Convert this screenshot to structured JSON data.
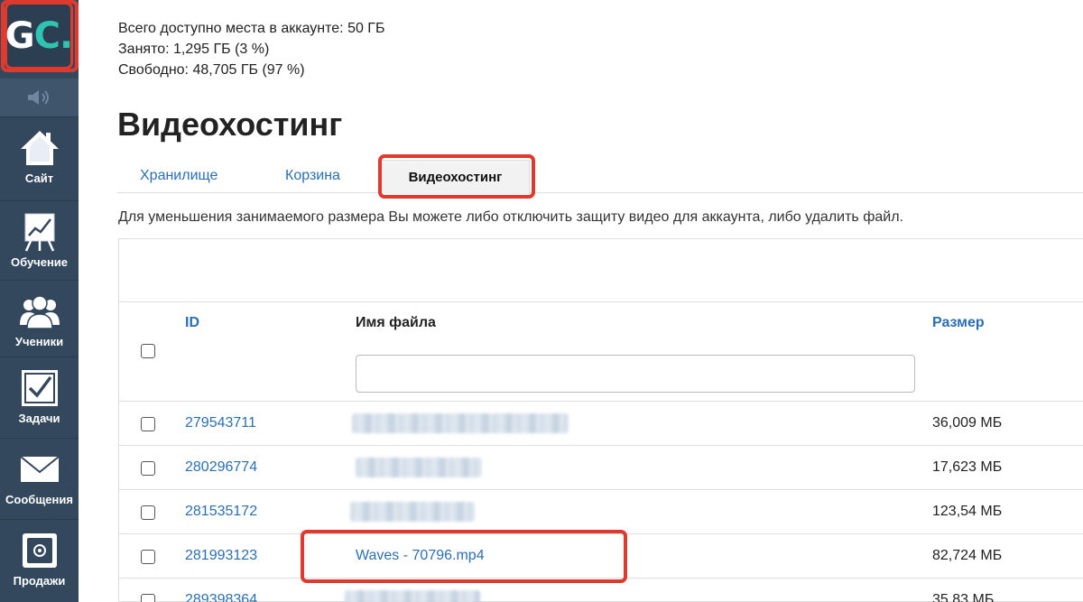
{
  "sidebar": {
    "logo": {
      "letter1": "G",
      "letter2": "C",
      "dot": "."
    },
    "speaker_icon": "speaker-icon",
    "items": [
      {
        "label": "Сайт",
        "icon": "house-icon"
      },
      {
        "label": "Обучение",
        "icon": "chart-board-icon"
      },
      {
        "label": "Ученики",
        "icon": "users-icon"
      },
      {
        "label": "Задачи",
        "icon": "checkbox-icon"
      },
      {
        "label": "Сообщения",
        "icon": "envelope-icon"
      },
      {
        "label": "Продажи",
        "icon": "safe-icon"
      }
    ]
  },
  "storage": {
    "total": "Всего доступно места в аккаунте: 50 ГБ",
    "used": "Занято: 1,295 ГБ (3 %)",
    "free": "Свободно: 48,705 ГБ (97 %)"
  },
  "page_title": "Видеохостинг",
  "tabs": [
    {
      "label": "Хранилище"
    },
    {
      "label": "Корзина"
    },
    {
      "label": "Видеохостинг",
      "active": true
    }
  ],
  "info_text": "Для уменьшения занимаемого размера Вы можете либо отключить защиту видео для аккаунта, либо удалить файл.",
  "table": {
    "columns": {
      "id": "ID",
      "filename": "Имя файла",
      "size": "Размер"
    },
    "filter_placeholder": "",
    "rows": [
      {
        "id": "279543711",
        "filename": "",
        "size": "36,009 МБ"
      },
      {
        "id": "280296774",
        "filename": "",
        "size": "17,623 МБ"
      },
      {
        "id": "281535172",
        "filename": "",
        "size": "123,54 МБ"
      },
      {
        "id": "281993123",
        "filename": "Waves - 70796.mp4",
        "size": "82,724 МБ"
      },
      {
        "id": "289398364",
        "filename": "",
        "size": "35,83 МБ"
      }
    ]
  },
  "colors": {
    "sidebar_bg": "#33485d",
    "link": "#2a6fb5",
    "highlight": "#e03a2e",
    "logo_accent": "#2ec4b0"
  }
}
